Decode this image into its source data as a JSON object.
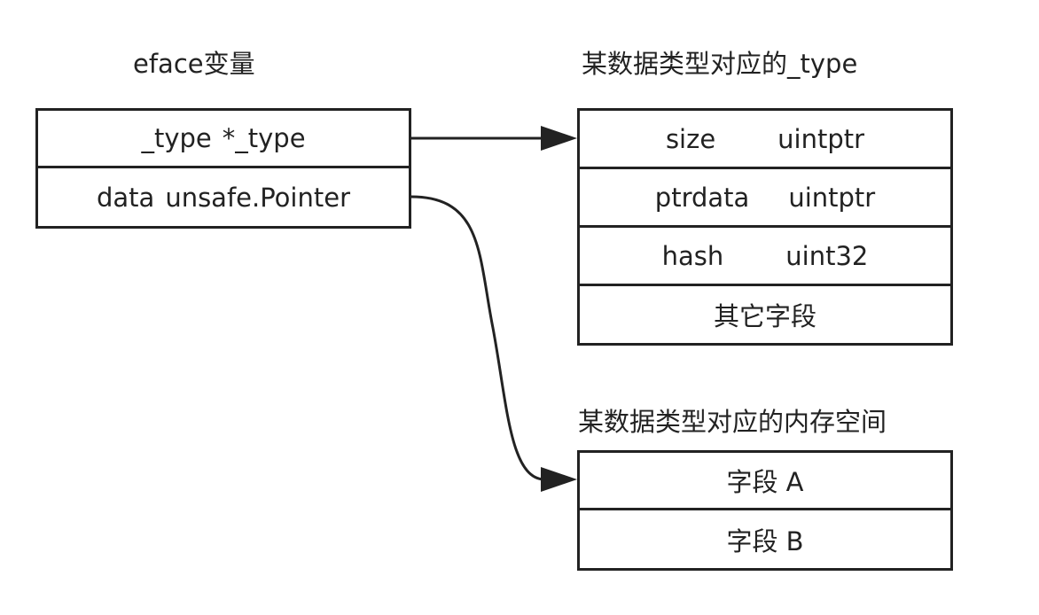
{
  "eface": {
    "caption": "eface变量",
    "rows": [
      {
        "name": "_type",
        "type": "*_type"
      },
      {
        "name": "data",
        "type": "unsafe.Pointer"
      }
    ]
  },
  "type_struct": {
    "caption": "某数据类型对应的_type",
    "rows": [
      {
        "name": "size",
        "type": "uintptr"
      },
      {
        "name": "ptrdata",
        "type": "uintptr"
      },
      {
        "name": "hash",
        "type": "uint32"
      },
      {
        "label": "其它字段"
      }
    ]
  },
  "memory": {
    "caption": "某数据类型对应的内存空间",
    "rows": [
      {
        "label": "字段 A"
      },
      {
        "label": "字段 B"
      }
    ]
  }
}
